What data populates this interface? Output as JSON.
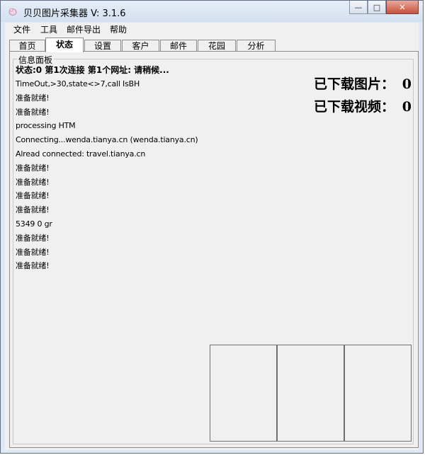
{
  "window": {
    "title": "贝贝图片采集器 V: 3.1.6",
    "controls": {
      "minimize": "—",
      "maximize": "□",
      "close": "✕"
    }
  },
  "menu": [
    "文件",
    "工具",
    "邮件导出",
    "帮助"
  ],
  "tabs": [
    {
      "label": "首页",
      "active": false
    },
    {
      "label": "状态",
      "active": true
    },
    {
      "label": "设置",
      "active": false
    },
    {
      "label": "客户",
      "active": false
    },
    {
      "label": "邮件",
      "active": false
    },
    {
      "label": "花园",
      "active": false
    },
    {
      "label": "分析",
      "active": false
    }
  ],
  "panel": {
    "group_title": "信息面板",
    "status_line": "状态:0 第1次连接 第1个网址: 请稍候...",
    "log": [
      "TimeOut,>30,state<>7,call IsBH",
      "准备就绪!",
      "准备就绪!",
      "processing HTM",
      "Connecting...wenda.tianya.cn (wenda.tianya.cn)",
      "Alread connected: travel.tianya.cn",
      "准备就绪!",
      "准备就绪!",
      "准备就绪!",
      "准备就绪!",
      "5349 0  gr",
      "准备就绪!",
      "准备就绪!",
      "准备就绪!"
    ],
    "downloaded_images_label": "已下载图片：",
    "downloaded_images_value": "0",
    "downloaded_videos_label": "已下载视频：",
    "downloaded_videos_value": "0"
  }
}
